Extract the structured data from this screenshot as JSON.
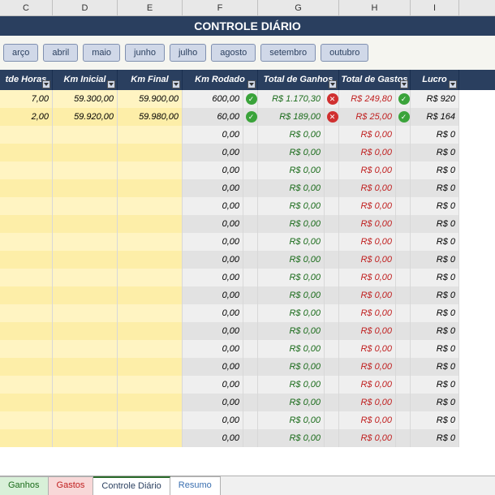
{
  "title": "CONTROLE DIÁRIO",
  "column_letters": [
    "C",
    "D",
    "E",
    "F",
    "G",
    "H",
    "I"
  ],
  "months": [
    "arço",
    "abril",
    "maio",
    "junho",
    "julho",
    "agosto",
    "setembro",
    "outubro"
  ],
  "headers": {
    "c": "tde Horas",
    "d": "Km Inicial",
    "e": "Km Final",
    "f": "Km Rodado",
    "g": "Total de Ganhos",
    "h": "Total de Gastos",
    "i": "Lucro"
  },
  "rows": [
    {
      "horas": "7,00",
      "ini": "59.300,00",
      "fin": "59.900,00",
      "rod": "600,00",
      "rb": "ok",
      "gan": "R$ 1.170,30",
      "gb": "no",
      "gas": "R$ 249,80",
      "hb": "ok",
      "luc": "R$ 920"
    },
    {
      "horas": "2,00",
      "ini": "59.920,00",
      "fin": "59.980,00",
      "rod": "60,00",
      "rb": "ok",
      "gan": "R$ 189,00",
      "gb": "no",
      "gas": "R$ 25,00",
      "hb": "ok",
      "luc": "R$ 164"
    },
    {
      "horas": "",
      "ini": "",
      "fin": "",
      "rod": "0,00",
      "rb": "",
      "gan": "R$ 0,00",
      "gb": "",
      "gas": "R$ 0,00",
      "hb": "",
      "luc": "R$ 0"
    },
    {
      "horas": "",
      "ini": "",
      "fin": "",
      "rod": "0,00",
      "rb": "",
      "gan": "R$ 0,00",
      "gb": "",
      "gas": "R$ 0,00",
      "hb": "",
      "luc": "R$ 0"
    },
    {
      "horas": "",
      "ini": "",
      "fin": "",
      "rod": "0,00",
      "rb": "",
      "gan": "R$ 0,00",
      "gb": "",
      "gas": "R$ 0,00",
      "hb": "",
      "luc": "R$ 0"
    },
    {
      "horas": "",
      "ini": "",
      "fin": "",
      "rod": "0,00",
      "rb": "",
      "gan": "R$ 0,00",
      "gb": "",
      "gas": "R$ 0,00",
      "hb": "",
      "luc": "R$ 0"
    },
    {
      "horas": "",
      "ini": "",
      "fin": "",
      "rod": "0,00",
      "rb": "",
      "gan": "R$ 0,00",
      "gb": "",
      "gas": "R$ 0,00",
      "hb": "",
      "luc": "R$ 0"
    },
    {
      "horas": "",
      "ini": "",
      "fin": "",
      "rod": "0,00",
      "rb": "",
      "gan": "R$ 0,00",
      "gb": "",
      "gas": "R$ 0,00",
      "hb": "",
      "luc": "R$ 0"
    },
    {
      "horas": "",
      "ini": "",
      "fin": "",
      "rod": "0,00",
      "rb": "",
      "gan": "R$ 0,00",
      "gb": "",
      "gas": "R$ 0,00",
      "hb": "",
      "luc": "R$ 0"
    },
    {
      "horas": "",
      "ini": "",
      "fin": "",
      "rod": "0,00",
      "rb": "",
      "gan": "R$ 0,00",
      "gb": "",
      "gas": "R$ 0,00",
      "hb": "",
      "luc": "R$ 0"
    },
    {
      "horas": "",
      "ini": "",
      "fin": "",
      "rod": "0,00",
      "rb": "",
      "gan": "R$ 0,00",
      "gb": "",
      "gas": "R$ 0,00",
      "hb": "",
      "luc": "R$ 0"
    },
    {
      "horas": "",
      "ini": "",
      "fin": "",
      "rod": "0,00",
      "rb": "",
      "gan": "R$ 0,00",
      "gb": "",
      "gas": "R$ 0,00",
      "hb": "",
      "luc": "R$ 0"
    },
    {
      "horas": "",
      "ini": "",
      "fin": "",
      "rod": "0,00",
      "rb": "",
      "gan": "R$ 0,00",
      "gb": "",
      "gas": "R$ 0,00",
      "hb": "",
      "luc": "R$ 0"
    },
    {
      "horas": "",
      "ini": "",
      "fin": "",
      "rod": "0,00",
      "rb": "",
      "gan": "R$ 0,00",
      "gb": "",
      "gas": "R$ 0,00",
      "hb": "",
      "luc": "R$ 0"
    },
    {
      "horas": "",
      "ini": "",
      "fin": "",
      "rod": "0,00",
      "rb": "",
      "gan": "R$ 0,00",
      "gb": "",
      "gas": "R$ 0,00",
      "hb": "",
      "luc": "R$ 0"
    },
    {
      "horas": "",
      "ini": "",
      "fin": "",
      "rod": "0,00",
      "rb": "",
      "gan": "R$ 0,00",
      "gb": "",
      "gas": "R$ 0,00",
      "hb": "",
      "luc": "R$ 0"
    },
    {
      "horas": "",
      "ini": "",
      "fin": "",
      "rod": "0,00",
      "rb": "",
      "gan": "R$ 0,00",
      "gb": "",
      "gas": "R$ 0,00",
      "hb": "",
      "luc": "R$ 0"
    },
    {
      "horas": "",
      "ini": "",
      "fin": "",
      "rod": "0,00",
      "rb": "",
      "gan": "R$ 0,00",
      "gb": "",
      "gas": "R$ 0,00",
      "hb": "",
      "luc": "R$ 0"
    },
    {
      "horas": "",
      "ini": "",
      "fin": "",
      "rod": "0,00",
      "rb": "",
      "gan": "R$ 0,00",
      "gb": "",
      "gas": "R$ 0,00",
      "hb": "",
      "luc": "R$ 0"
    },
    {
      "horas": "",
      "ini": "",
      "fin": "",
      "rod": "0,00",
      "rb": "",
      "gan": "R$ 0,00",
      "gb": "",
      "gas": "R$ 0,00",
      "hb": "",
      "luc": "R$ 0"
    }
  ],
  "tabs": {
    "ganhos": "Ganhos",
    "gastos": "Gastos",
    "controle": "Controle Diário",
    "resumo": "Resumo"
  },
  "badge_glyphs": {
    "ok": "✓",
    "no": "✕"
  }
}
